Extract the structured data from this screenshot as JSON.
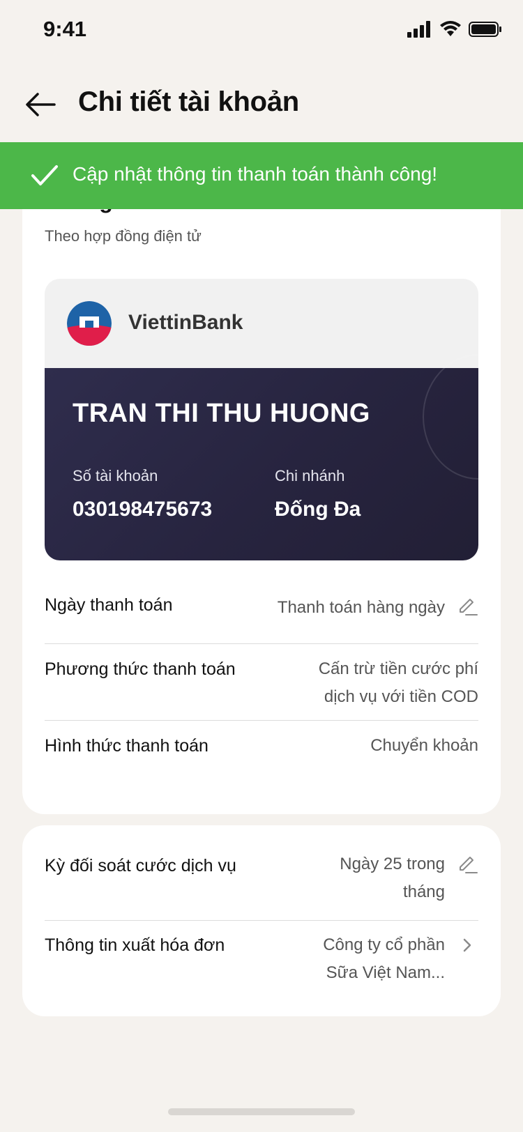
{
  "status": {
    "time": "9:41"
  },
  "nav": {
    "title": "Chi tiết tài khoản"
  },
  "toast": {
    "message": "Cập nhật thông tin thanh toán thành công!",
    "color": "#4cb749"
  },
  "account_section": {
    "title": "Thông tin tài khoản",
    "subtitle": "Theo hợp đồng điện tử",
    "bank_card": {
      "bank_name": "ViettinBank",
      "holder_name": "TRAN THI THU HUONG",
      "account_label": "Số tài khoản",
      "account_number": "030198475673",
      "branch_label": "Chi nhánh",
      "branch_name": "Đống Đa"
    },
    "rows": [
      {
        "label": "Ngày thanh toán",
        "value": "Thanh toán hàng ngày",
        "icon": "edit-icon"
      },
      {
        "label": "Phương thức thanh toán",
        "value_line1": "Cấn trừ tiền cước phí",
        "value_line2": "dịch vụ với tiền COD"
      },
      {
        "label": "Hình thức thanh toán",
        "value": "Chuyển khoản"
      }
    ]
  },
  "service_section": {
    "rows": [
      {
        "label": "Kỳ đối soát cước dịch vụ",
        "value_line1": "Ngày 25 trong",
        "value_line2": "tháng",
        "icon": "edit-icon"
      },
      {
        "label": "Thông tin xuất hóa đơn",
        "value_line1": "Công ty cổ phần",
        "value_line2": "Sữa Việt Nam...",
        "icon": "chevron-right-icon"
      }
    ]
  }
}
